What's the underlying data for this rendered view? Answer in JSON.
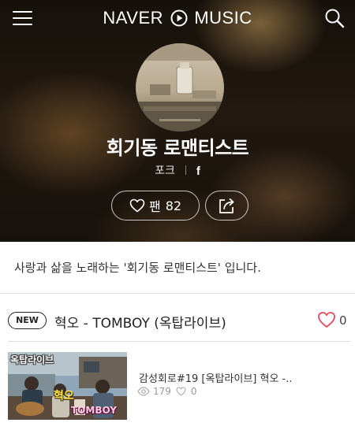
{
  "header": {
    "logo_left": "NAVER",
    "logo_right": "MUSIC",
    "menu_icon": "hamburger-menu-icon",
    "search_icon": "search-icon"
  },
  "artist": {
    "name": "회기동 로맨티스트",
    "genre": "포크",
    "social_icon": "facebook-icon",
    "fan_label": "팬",
    "fan_count": "82"
  },
  "description": "사랑과 삶을 노래하는 '회기동 로맨티스트' 입니다.",
  "new_release": {
    "badge": "NEW",
    "title": "혁오 - TOMBOY (옥탑라이브)",
    "like_count": "0"
  },
  "videos": [
    {
      "thumbnail_label": "옥탑라이브",
      "thumbnail_caption_a": "혁오",
      "thumbnail_caption_b": "TOMBOY",
      "title": "감성회로#19 [옥탑라이브] 혁오 -..",
      "views": "179",
      "likes": "0"
    }
  ],
  "colors": {
    "like_heart": "#e8495a",
    "text_primary": "#222222",
    "text_muted": "#9a9a9a"
  }
}
